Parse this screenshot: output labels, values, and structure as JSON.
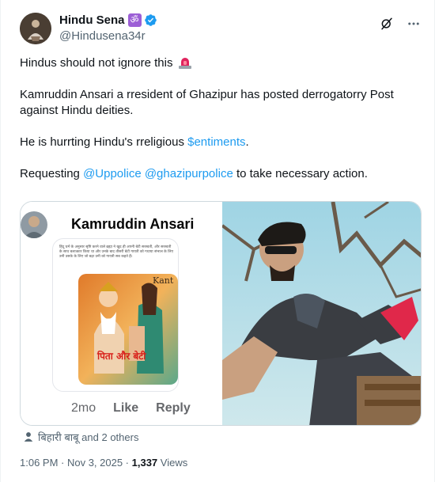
{
  "author": {
    "display_name": "Hindu Sena",
    "badge_glyph": "ॐ",
    "handle": "@Hindusena34r"
  },
  "tweet": {
    "line1": "Hindus should not ignore this",
    "line2": "Kamruddin Ansari a rresident of Ghazipur has posted derrogatorry Post against Hindu deities.",
    "line3_pre": "He is hurrting Hindu's rreligious ",
    "line3_hashtag": "$entiments",
    "line3_post": ".",
    "line4_pre": "Requesting ",
    "mention1": "@Uppolice",
    "mention2": "@ghazipurpolice",
    "line4_post": " to take necessary action."
  },
  "media": {
    "fb_name": "Kamruddin Ansari",
    "fb_post_text": "हिंदू धर्म के अनुसार सृष्टि करने वाले ब्रह्मा ने खुद ही अपनी बेटी सरस्वती, और सरस्वती के साथ बलात्कार किया था और उनके बाद तीसरी बेटी गायत्री को गधाया संभाल के लिए उनी उसके के लिए जो बढ़ा उनी को गायत्री सब कहते हैं।",
    "fb_image_label": "Kant",
    "fb_image_caption": "पिता और बेटी",
    "fb_time": "2mo",
    "fb_like": "Like",
    "fb_reply": "Reply"
  },
  "likes_text": "बिहारी बाबू and 2 others",
  "meta": {
    "timestamp": "1:06 PM · Nov 3, 2025 · ",
    "views_count": "1,337",
    "views_label": " Views"
  },
  "colors": {
    "accent": "#1d9bf0",
    "verified": "#1d9bf0",
    "secondary_text": "#536471"
  }
}
